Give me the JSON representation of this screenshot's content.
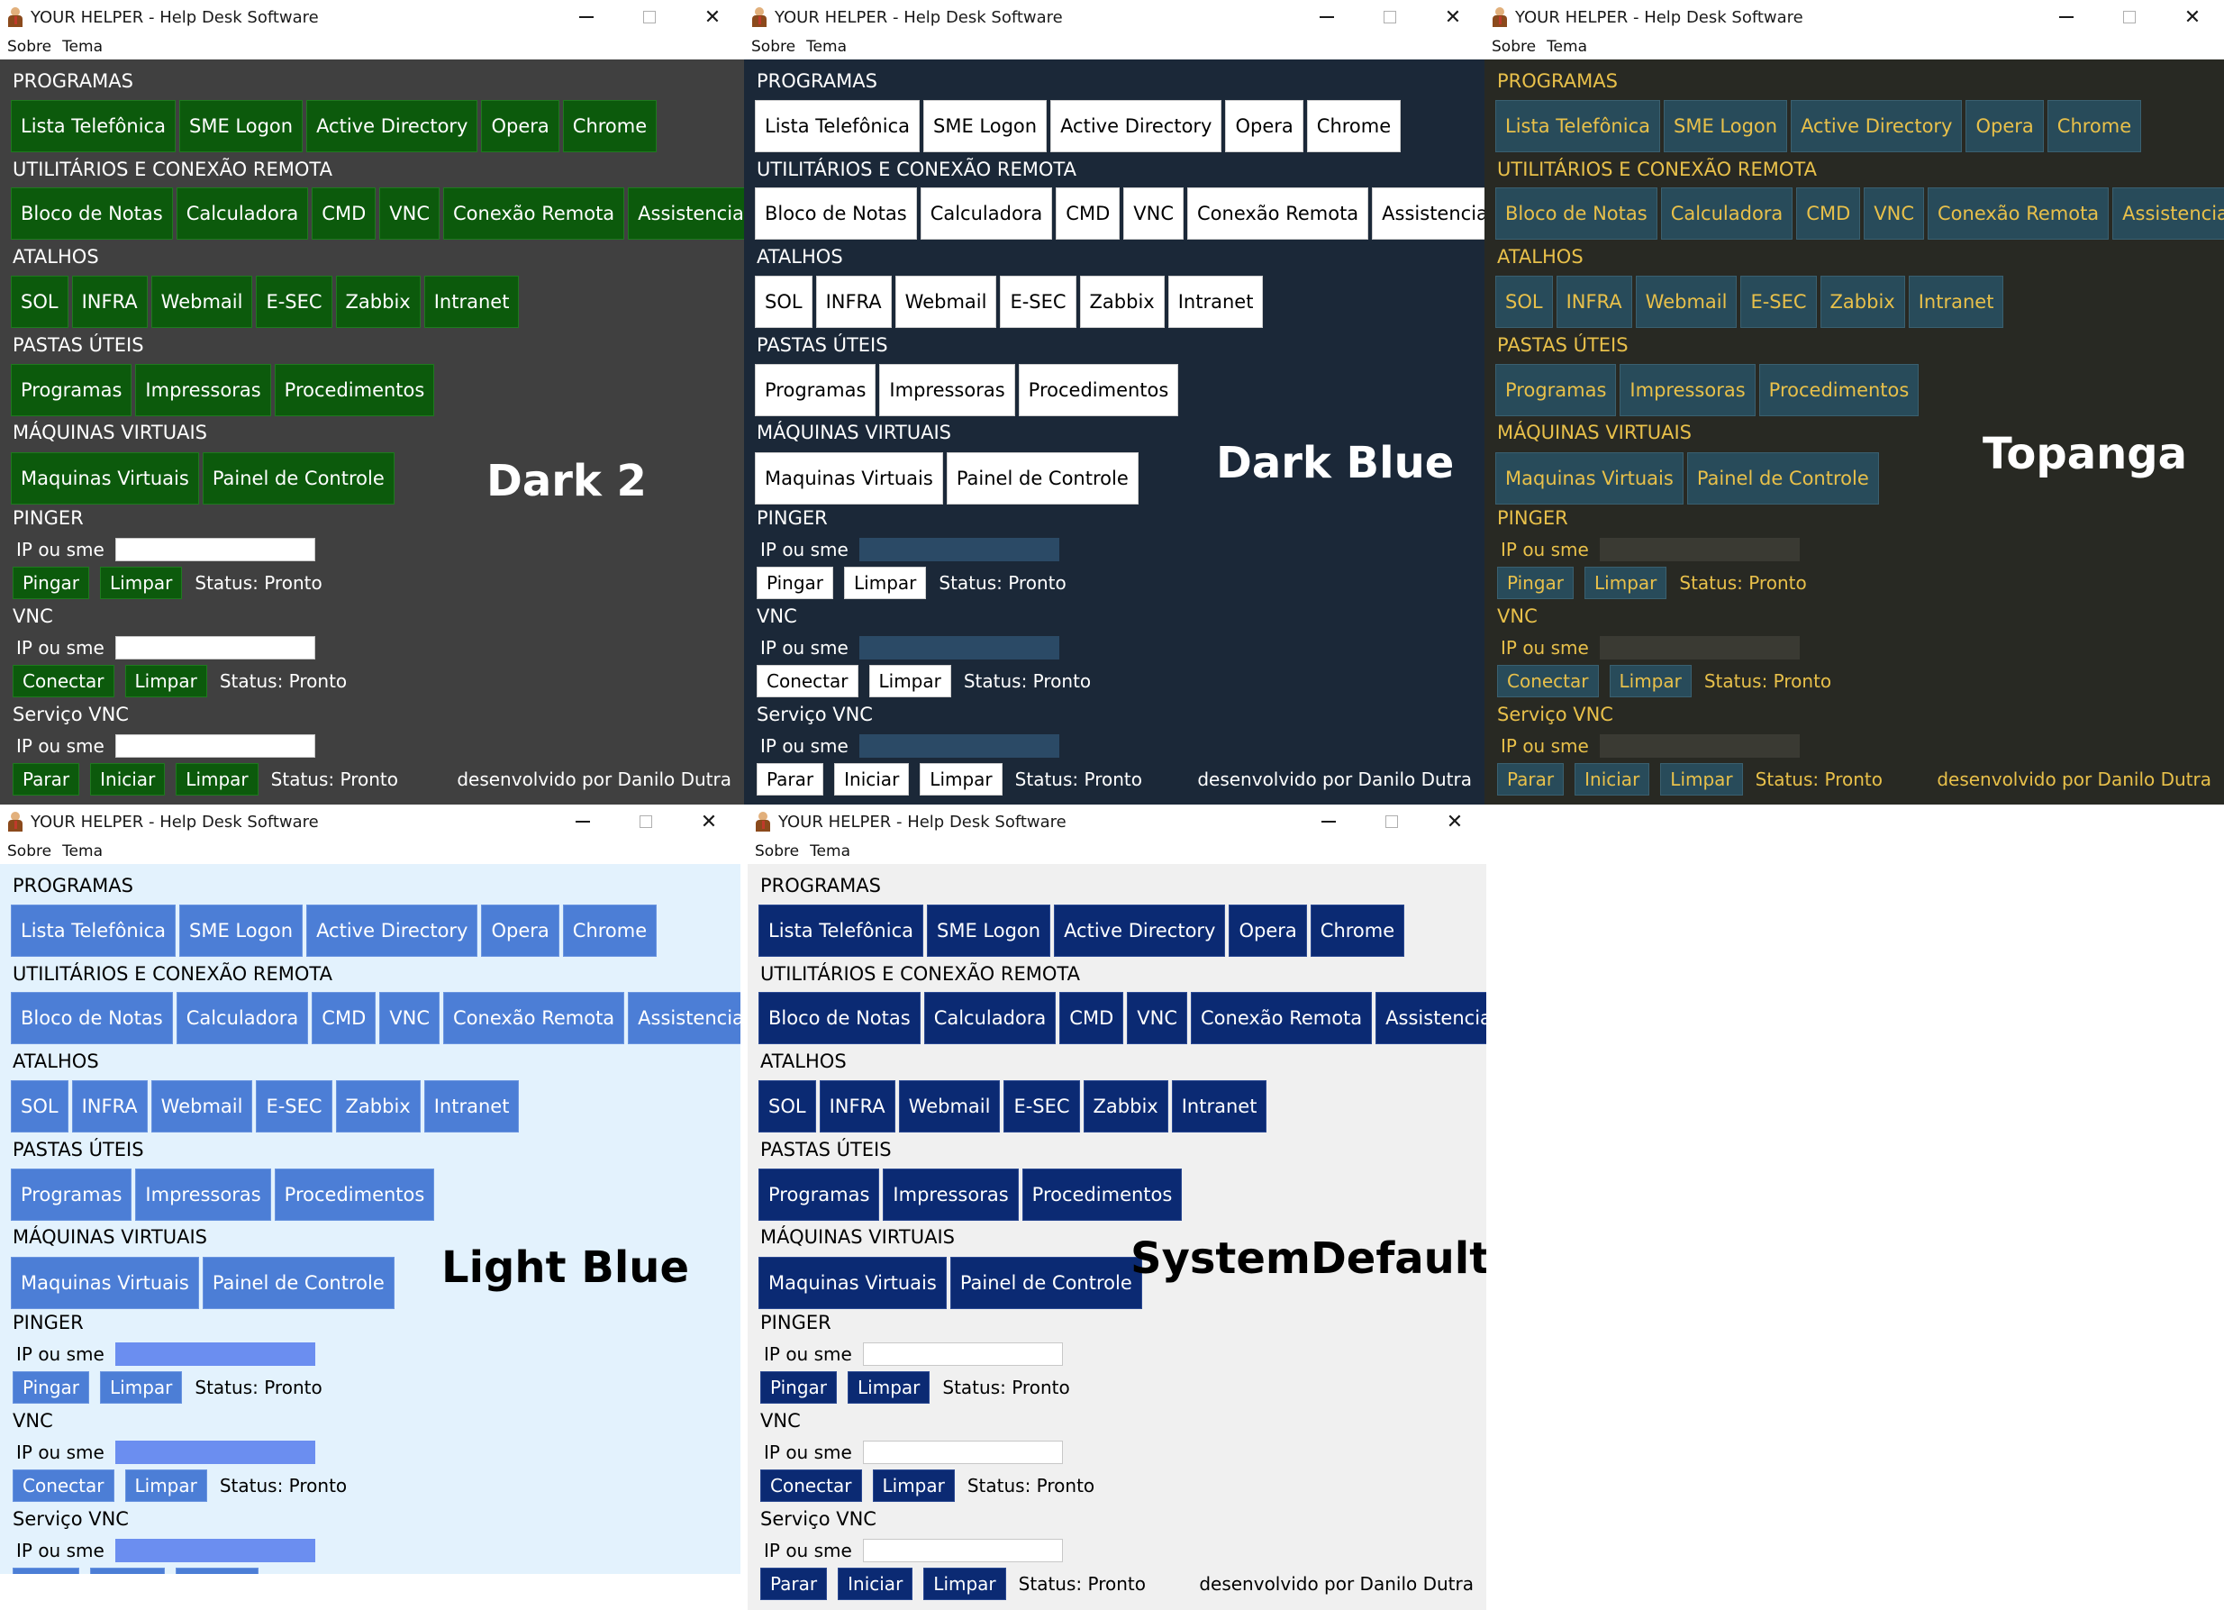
{
  "app": {
    "title": "YOUR HELPER - Help Desk Software",
    "menu": [
      "Sobre",
      "Tema"
    ]
  },
  "sections": {
    "programas": "PROGRAMAS",
    "utilitarios": "UTILITÁRIOS E CONEXÃO REMOTA",
    "atalhos": "ATALHOS",
    "pastas": "PASTAS ÚTEIS",
    "maquinas": "MÁQUINAS VIRTUAIS",
    "pinger": "PINGER",
    "vnc": "VNC",
    "servico_vnc": "Serviço VNC"
  },
  "buttons": {
    "programas": [
      "Lista Telefônica",
      "SME Logon",
      "Active Directory",
      "Opera",
      "Chrome"
    ],
    "utilitarios": [
      "Bloco de Notas",
      "Calculadora",
      "CMD",
      "VNC",
      "Conexão Remota",
      "Assistencia Remota"
    ],
    "atalhos": [
      "SOL",
      "INFRA",
      "Webmail",
      "E-SEC",
      "Zabbix",
      "Intranet"
    ],
    "pastas": [
      "Programas",
      "Impressoras",
      "Procedimentos"
    ],
    "maquinas": [
      "Maquinas Virtuais",
      "Painel de Controle"
    ]
  },
  "pinger": {
    "field_label": "IP ou sme",
    "action": "Pingar",
    "clear": "Limpar",
    "status": "Status: Pronto"
  },
  "vnc": {
    "field_label": "IP ou sme",
    "action": "Conectar",
    "clear": "Limpar",
    "status": "Status: Pronto"
  },
  "servico_vnc": {
    "field_label": "IP ou sme",
    "stop": "Parar",
    "start": "Iniciar",
    "clear": "Limpar",
    "status": "Status: Pronto"
  },
  "footer": "desenvolvido por Danilo Dutra",
  "themes": [
    {
      "name": "Dark 2",
      "bg": "#404040",
      "fg": "#ffffff",
      "btn_bg": "#0c5a0c",
      "btn_fg": "#ffffff",
      "btn_border": "#1e7a1e",
      "input_bg": "#ffffff",
      "name_color": "#ffffff",
      "dark_titlebar": false
    },
    {
      "name": "Dark Blue",
      "bg": "#1b2838",
      "fg": "#ffffff",
      "btn_bg": "#ffffff",
      "btn_fg": "#000000",
      "btn_border": "#cfcfcf",
      "input_bg": "#2b4a66",
      "name_color": "#ffffff",
      "dark_titlebar": false
    },
    {
      "name": "Topanga",
      "bg": "#282923",
      "fg": "#e8c04a",
      "btn_bg": "#284b5a",
      "btn_fg": "#e8c04a",
      "btn_border": "#3a6070",
      "input_bg": "#3a3a33",
      "name_color": "#ffffff",
      "dark_titlebar": false
    },
    {
      "name": "Light  Blue",
      "bg": "#e3f2fd",
      "fg": "#000000",
      "btn_bg": "#4c7ed6",
      "btn_fg": "#ffffff",
      "btn_border": "#6a95e0",
      "input_bg": "#6b8ef0",
      "name_color": "#000000",
      "dark_titlebar": false
    },
    {
      "name": "SystemDefault",
      "bg": "#f0f0f0",
      "fg": "#000000",
      "btn_bg": "#0b2a73",
      "btn_fg": "#ffffff",
      "btn_border": "#2c4a93",
      "input_bg": "#ffffff",
      "name_color": "#000000",
      "dark_titlebar": false
    }
  ]
}
